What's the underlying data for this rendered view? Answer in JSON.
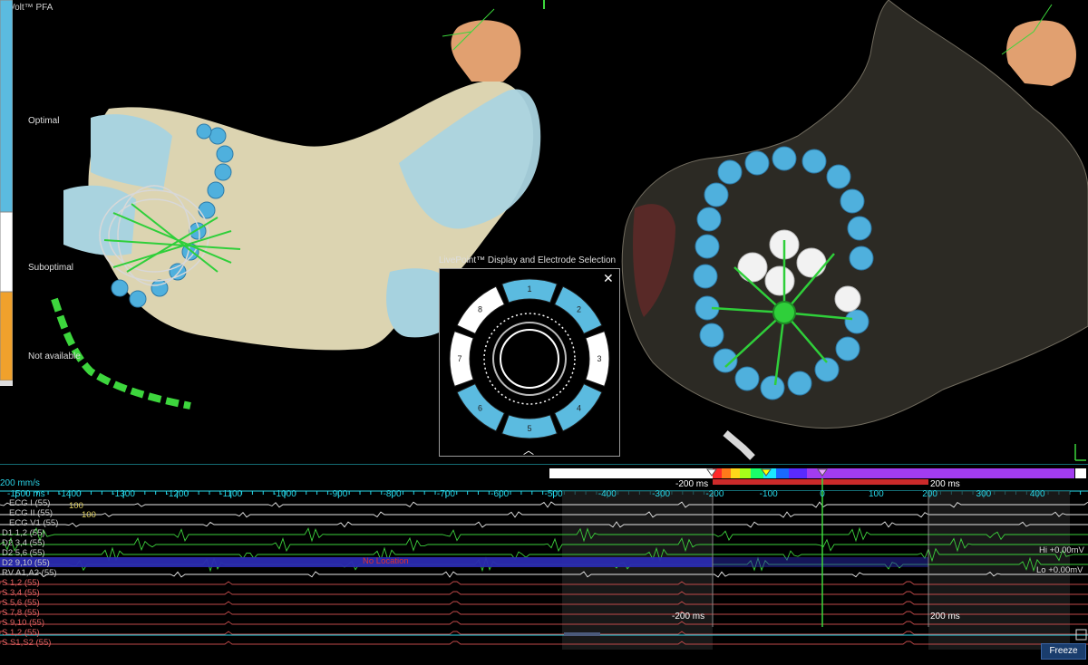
{
  "legend": {
    "title": "Volt™ PFA",
    "labels": [
      "Optimal",
      "Suboptimal",
      "Not available"
    ],
    "colors": {
      "optimal": "#5bbbe0",
      "suboptimal": "#ffffff",
      "not_available": "#f0a12c"
    }
  },
  "electrode_popup": {
    "title": "LivePoint™ Display and Electrode Selection",
    "close_icon": "close-icon",
    "chevron_icon": "chevron-up-icon",
    "segments": [
      "1",
      "2",
      "3",
      "4",
      "5",
      "6",
      "7",
      "8"
    ],
    "segment_states": [
      "blue",
      "blue",
      "white",
      "blue",
      "blue",
      "blue",
      "white",
      "white"
    ]
  },
  "timeline": {
    "speed": "200 mm/s",
    "range_label": "-1500 ms",
    "ticks": [
      "-1400",
      "-1300",
      "-1200",
      "-1100",
      "-1000",
      "-900",
      "-800",
      "-700",
      "-600",
      "-500",
      "-400",
      "-300",
      "-200",
      "-100",
      "0",
      "100",
      "200",
      "300",
      "400"
    ],
    "window_left": "-200 ms",
    "window_right": "200 ms",
    "window_left_bottom": "-200 ms",
    "window_right_bottom": "200 ms",
    "traces": [
      "ECG I (55)",
      "ECG II (55)",
      "ECG V1 (55)",
      "D1 1,2 (55)",
      "D2 3,4 (55)",
      "D2 5,6 (55)",
      "D2 9,10 (55)",
      "RV A1,A2 (55)",
      "S 1,2 (55)",
      "S 3,4 (55)",
      "S 5,6 (55)",
      "S 7,8 (55)",
      "S 9,10 (55)",
      "S 1,2 (55)",
      "S S1,S2 (55)"
    ],
    "ecg_scale": "100",
    "no_location": "No Location",
    "hi_label": "Hi +0.00mV",
    "lo_label": "Lo +0.00mV",
    "freeze_label": "Freeze"
  },
  "colors": {
    "accent": "#27d7e8",
    "trace_green": "#3ccf3c",
    "trace_white": "#e8e8e8",
    "trace_red": "#c04a4a",
    "highlight_band": "#2a2ab0"
  }
}
